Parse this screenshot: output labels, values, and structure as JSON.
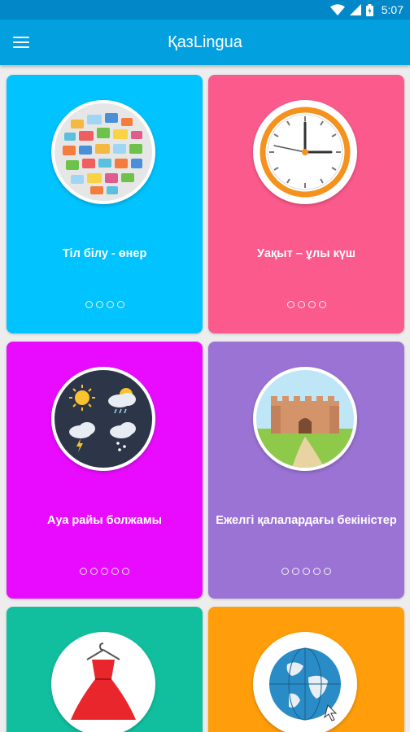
{
  "status_bar": {
    "time": "5:07",
    "icons": [
      "wifi-icon",
      "signal-icon",
      "battery-icon"
    ]
  },
  "app_bar": {
    "title": "ҚазLingua",
    "menu_icon": "hamburger-menu-icon"
  },
  "cards": [
    {
      "title": "Тіл білу - өнер",
      "color": "#00c3ff",
      "icon": "speech-bubbles-icon",
      "dots": 4
    },
    {
      "title": "Уақыт – ұлы күш",
      "color": "#fb5a8c",
      "icon": "clock-icon",
      "dots": 4
    },
    {
      "title": "Ауа райы болжамы",
      "color": "#e90bff",
      "icon": "weather-icon",
      "dots": 5
    },
    {
      "title": "Ежелгі қалалардағы бекіністер",
      "color": "#9b73d4",
      "icon": "fortress-icon",
      "dots": 5
    },
    {
      "title": "",
      "color": "#11bf9f",
      "icon": "dress-icon",
      "dots": 0
    },
    {
      "title": "",
      "color": "#ff9e0a",
      "icon": "globe-icon",
      "dots": 0
    }
  ]
}
